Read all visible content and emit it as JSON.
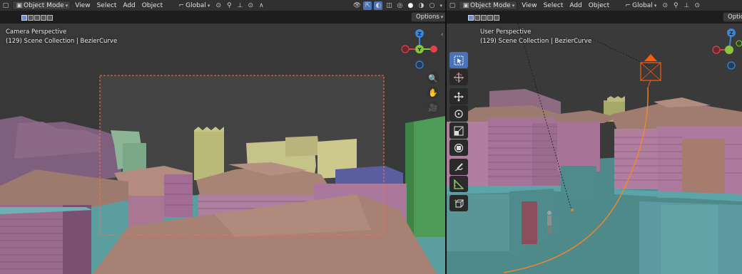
{
  "left": {
    "mode_label": "Object Mode",
    "menus": [
      "View",
      "Select",
      "Add",
      "Object"
    ],
    "orientation_label": "Global",
    "options_label": "Options",
    "view_name": "Camera Perspective",
    "collection_info": "(129) Scene Collection | BezierCurve",
    "gizmo": {
      "z": "Z",
      "y": "Y"
    }
  },
  "right": {
    "mode_label": "Object Mode",
    "menus": [
      "View",
      "Select",
      "Add",
      "Object"
    ],
    "orientation_label": "Global",
    "options_label": "Optio",
    "view_name": "User Perspective",
    "collection_info": "(129) Scene Collection | BezierCurve",
    "gizmo": {
      "z": "Z"
    }
  },
  "icons": {
    "toolbar": [
      "select-box-icon",
      "cursor-icon",
      "move-icon",
      "rotate-icon",
      "scale-icon",
      "transform-icon",
      "annotate-icon",
      "measure-icon",
      "add-cube-icon"
    ],
    "nav": [
      "zoom-icon",
      "hand-pan-icon",
      "camera-view-icon"
    ]
  },
  "colors": {
    "header_bg": "#303030",
    "viewport_bg": "#3b3b3b",
    "active_tool": "#4a72b6",
    "axis_x": "#e0414f",
    "axis_y": "#8bc53f",
    "axis_z": "#3a86d8",
    "camera_orange": "#ff5a0a",
    "curve_orange": "#f0872a",
    "camera_frame": "#ff6b52"
  }
}
